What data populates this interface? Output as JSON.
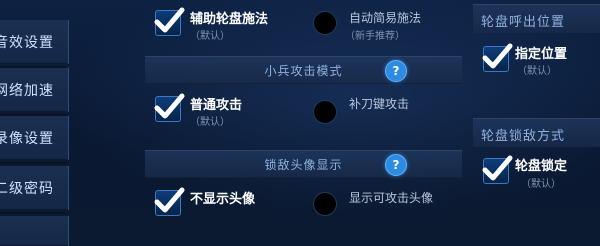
{
  "left_nav": {
    "items": [
      {
        "label": "音效设置"
      },
      {
        "label": "网络加速"
      },
      {
        "label": "录像设置"
      },
      {
        "label": "二级密码"
      }
    ]
  },
  "auto_cast": {
    "option_a": {
      "label": "辅助轮盘施法",
      "sub": "（默认）",
      "checked": true
    },
    "option_b": {
      "label": "自动简易施法",
      "sub": "（新手推荐）",
      "checked": false
    }
  },
  "minion_attack": {
    "title": "小兵攻击模式",
    "help": "?",
    "option_a": {
      "label": "普通攻击",
      "sub": "（默认）",
      "checked": true
    },
    "option_b": {
      "label": "补刀键攻击",
      "checked": false
    }
  },
  "lock_avatar": {
    "title": "锁敌头像显示",
    "help": "?",
    "option_a": {
      "label": "不显示头像",
      "checked": true
    },
    "option_b": {
      "label": "显示可攻击头像",
      "checked": false
    }
  },
  "wheel_position": {
    "title": "轮盘呼出位置",
    "option": {
      "label": "指定位置",
      "sub": "（默认）",
      "checked": true
    }
  },
  "wheel_lock": {
    "title": "轮盘锁敌方式",
    "option": {
      "label": "轮盘锁定",
      "sub": "（默认）",
      "checked": true
    }
  },
  "colors": {
    "accent": "#2c8be2",
    "background": "#0b1a33",
    "check": "#ffffff"
  }
}
